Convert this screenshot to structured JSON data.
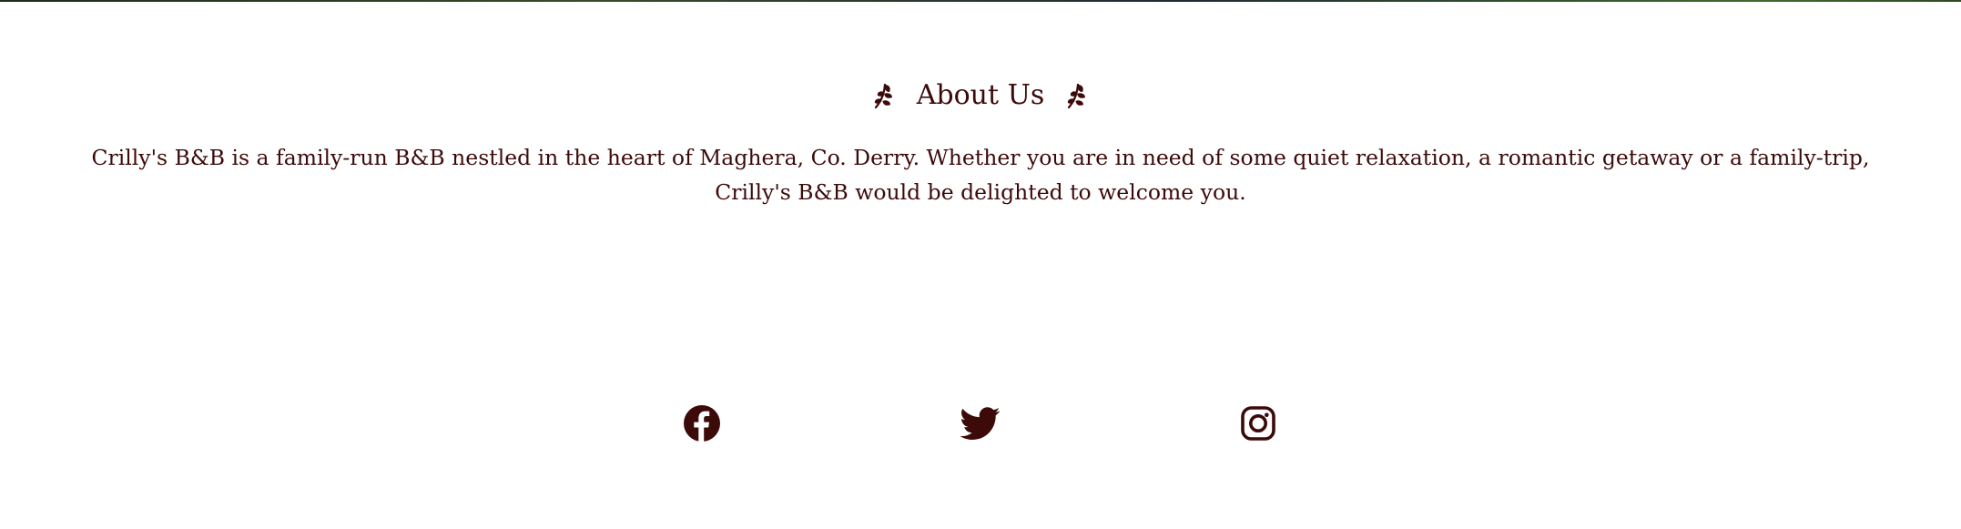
{
  "about": {
    "title": "About Us",
    "leaf_icon": "leaf-sprig-icon",
    "paragraph": "Crilly's B&B is a family-run B&B nestled in the heart of Maghera, Co. Derry. Whether you are in need of some quiet relaxation, a romantic getaway or a family-trip, Crilly's B&B would be delighted to welcome you."
  },
  "social": {
    "links": [
      {
        "icon": "facebook-icon",
        "service": "facebook"
      },
      {
        "icon": "twitter-icon",
        "service": "twitter"
      },
      {
        "icon": "instagram-icon",
        "service": "instagram"
      }
    ]
  },
  "colors": {
    "text": "#3d0a0a",
    "background": "#ffffff"
  }
}
